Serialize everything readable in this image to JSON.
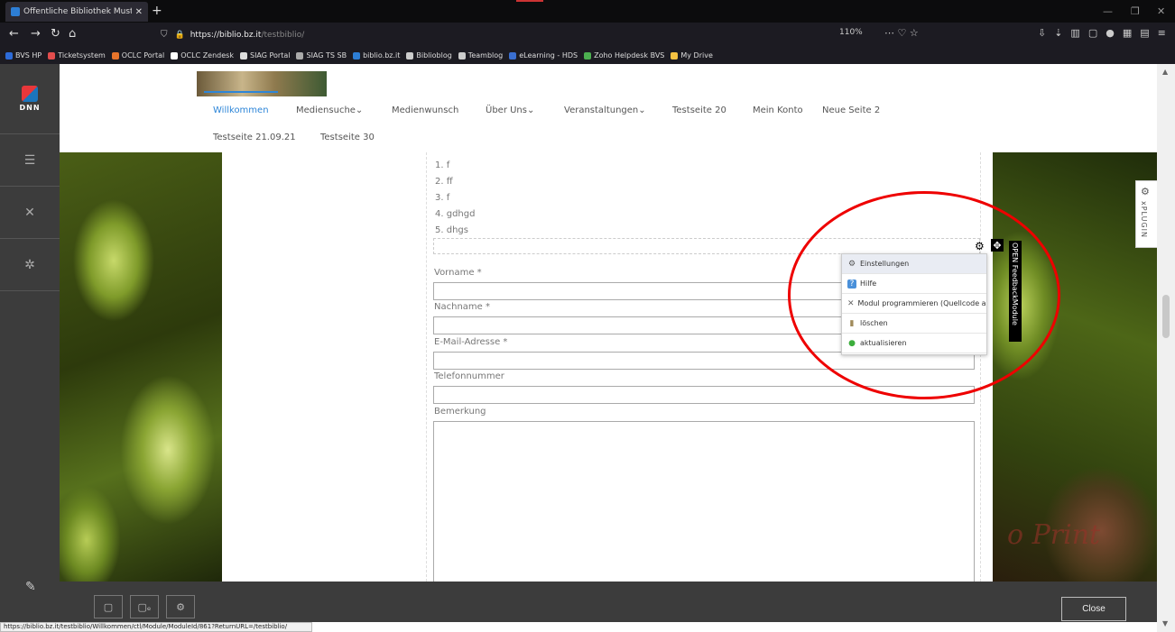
{
  "browser": {
    "tab_title": "Öffentliche Bibliothek Muster",
    "new_tab": "+",
    "url_host": "https://biblio.bz.it",
    "url_path": "/testbiblio/",
    "zoom": "110%",
    "status_url": "https://biblio.bz.it/testbiblio/Willkommen/ctl/Module/ModuleId/861?ReturnURL=/testbiblio/"
  },
  "bookmarks": [
    {
      "label": "BVS HP",
      "color": "#2d6bd8"
    },
    {
      "label": "Ticketsystem",
      "color": "#e24d4d"
    },
    {
      "label": "OCLC Portal",
      "color": "#e7742b"
    },
    {
      "label": "OCLC Zendesk",
      "color": "#ffffff"
    },
    {
      "label": "SIAG Portal",
      "color": "#dddddd"
    },
    {
      "label": "SIAG TS SB",
      "color": "#aaaaaa"
    },
    {
      "label": "biblio.bz.it",
      "color": "#2d7ed5"
    },
    {
      "label": "Biblioblog",
      "color": "#cccccc"
    },
    {
      "label": "Teamblog",
      "color": "#cccccc"
    },
    {
      "label": "eLearning - HDS",
      "color": "#3a6fd1"
    },
    {
      "label": "Zoho Helpdesk BVS",
      "color": "#4caf50"
    },
    {
      "label": "My Drive",
      "color": "#f5c242"
    }
  ],
  "dnn": {
    "logo_text": "DNN"
  },
  "site_menu": {
    "row1": [
      "Willkommen",
      "Mediensuche⌄",
      "Medienwunsch",
      "Über Uns⌄",
      "Veranstaltungen⌄",
      "Testseite 20",
      "Mein Konto",
      "Neue Seite 2"
    ],
    "row2": [
      "Testseite 21.09.21",
      "Testseite 30"
    ]
  },
  "list_items": [
    "1. f",
    "2. ff",
    "3. f",
    "4. gdhgd",
    "5. dhgs"
  ],
  "form": {
    "vorname": "Vorname *",
    "nachname": "Nachname *",
    "email": "E-Mail-Adresse *",
    "telefon": "Telefonnummer",
    "bemerkung": "Bemerkung"
  },
  "module": {
    "title": "OPEN FeedbackModule",
    "actions": [
      {
        "label": "Einstellungen",
        "icon": "gear-icon",
        "color": "#555555"
      },
      {
        "label": "Hilfe",
        "icon": "help-icon",
        "color": "#4a90d9"
      },
      {
        "label": "Modul programmieren (Quellcode an",
        "icon": "tools-icon",
        "color": "#666666"
      },
      {
        "label": "löschen",
        "icon": "trash-icon",
        "color": "#a08a5a"
      },
      {
        "label": "aktualisieren",
        "icon": "refresh-icon",
        "color": "#3cae3c"
      }
    ]
  },
  "xplugin": {
    "label": "xPLUGIN"
  },
  "watermark": "o Print",
  "bottom": {
    "close": "Close"
  },
  "accent_color": "#2e86d8",
  "highlight_color": "#e00000"
}
